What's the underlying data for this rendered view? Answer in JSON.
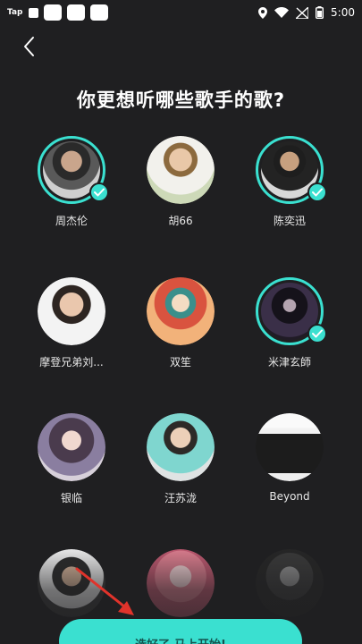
{
  "status_bar": {
    "app_tag": "Tap",
    "time": "5:00",
    "icons": [
      "location-icon",
      "wifi-icon",
      "signal-off-icon",
      "battery-icon"
    ]
  },
  "header": {
    "back_icon": "chevron-left-icon",
    "title": "你更想听哪些歌手的歌?"
  },
  "artists": [
    {
      "name": "周杰伦",
      "selected": true
    },
    {
      "name": "胡66",
      "selected": false
    },
    {
      "name": "陈奕迅",
      "selected": true
    },
    {
      "name": "摩登兄弟刘...",
      "selected": false
    },
    {
      "name": "双笙",
      "selected": false
    },
    {
      "name": "米津玄師",
      "selected": true
    },
    {
      "name": "银临",
      "selected": false
    },
    {
      "name": "汪苏泷",
      "selected": false
    },
    {
      "name": "Beyond",
      "selected": false
    },
    {
      "name": "",
      "selected": false
    },
    {
      "name": "",
      "selected": false
    },
    {
      "name": "",
      "selected": false
    }
  ],
  "footer": {
    "start_label": "选好了,马上开始!"
  },
  "colors": {
    "accent": "#3ae0d0",
    "background": "#1f1f21",
    "arrow": "#e0332b"
  }
}
